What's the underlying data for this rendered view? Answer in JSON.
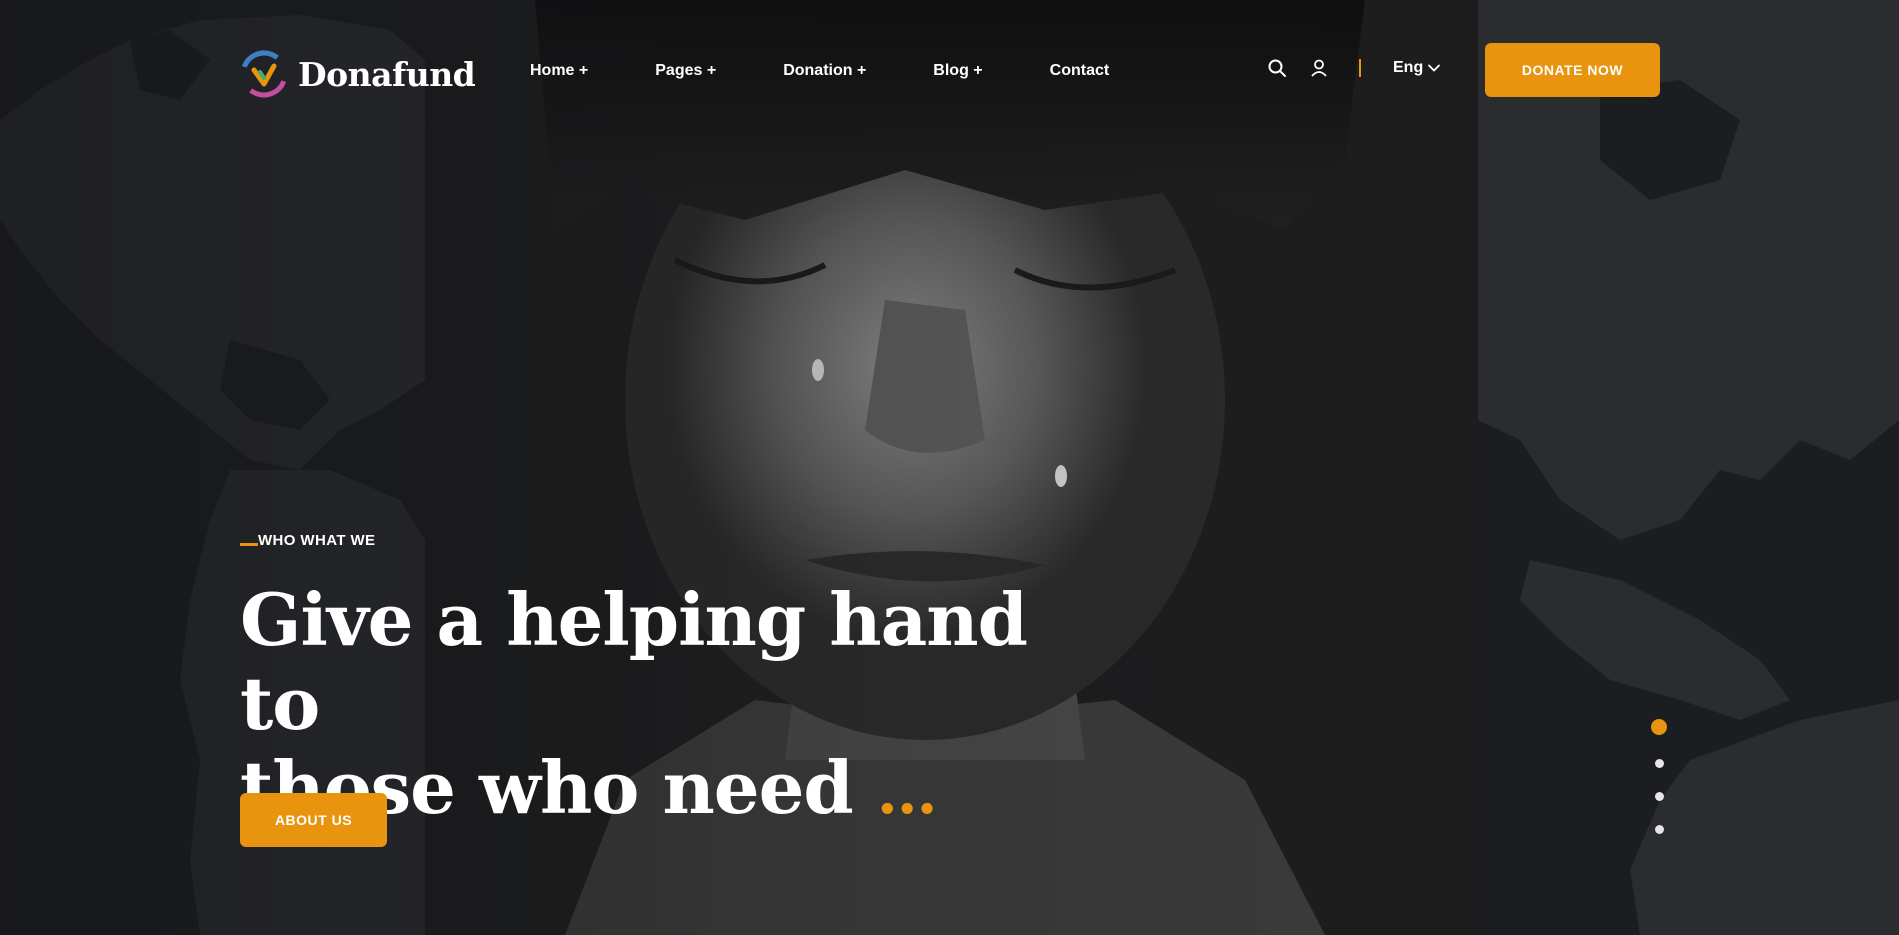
{
  "brand": {
    "name": "Donafund",
    "logo_icon": "donafund-logo-icon"
  },
  "nav": {
    "items": [
      {
        "label": "Home +"
      },
      {
        "label": "Pages +"
      },
      {
        "label": "Donation +"
      },
      {
        "label": "Blog +"
      },
      {
        "label": "Contact"
      }
    ]
  },
  "tools": {
    "search_icon": "search-icon",
    "user_icon": "user-icon",
    "language": "Eng",
    "language_icon": "chevron-down-icon"
  },
  "cta": {
    "donate_label": "DONATE NOW"
  },
  "hero": {
    "eyebrow": "WHO WHAT WE",
    "headline_line1": "Give a helping hand to",
    "headline_line2": "those who need",
    "headline_ellipsis": "...",
    "about_label": "ABOUT US"
  },
  "slider": {
    "total_slides": 4,
    "active_slide": 1
  },
  "colors": {
    "accent": "#e8940f",
    "background": "#1c1d20",
    "map": "#2e2f33",
    "text": "#ffffff"
  }
}
